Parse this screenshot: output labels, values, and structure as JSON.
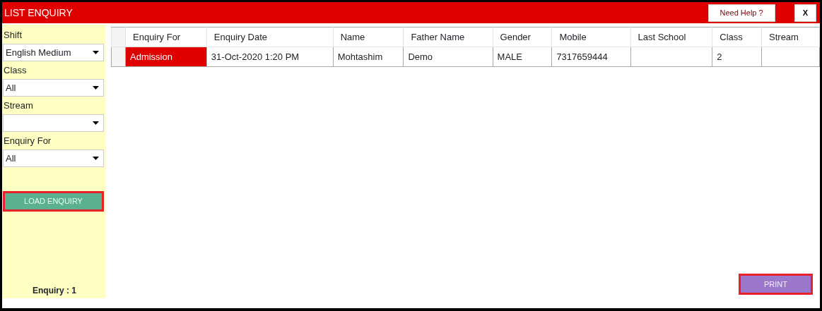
{
  "window": {
    "title": "LIST ENQUIRY"
  },
  "header_buttons": [
    {
      "kind": "help",
      "label": "Need Help ?"
    },
    {
      "kind": "close",
      "label": "X"
    }
  ],
  "filters": [
    {
      "label": "Shift",
      "value": "English Medium"
    },
    {
      "label": "Class",
      "value": "All"
    },
    {
      "label": "Stream"
    },
    {
      "label": "Enquiry For",
      "value": "All"
    }
  ],
  "load_button": "LOAD ENQUIRY",
  "count": "Enquiry : 1",
  "table": {
    "columns": [
      "Enquiry For",
      "Enquiry Date",
      "Name",
      "Father Name",
      "Gender",
      "Mobile",
      "Last School",
      "Class",
      "Stream"
    ],
    "rows": [
      {
        "cells": [
          {
            "text": "Admission",
            "selected": true
          },
          {
            "text": "31-Oct-2020 1:20 PM",
            "selected": false
          },
          {
            "text": "Mohtashim",
            "selected": false
          },
          {
            "text": "Demo",
            "selected": false
          },
          {
            "text": "MALE",
            "selected": false
          },
          {
            "text": "7317659444",
            "selected": false
          },
          {
            "selected": false
          },
          {
            "text": "2",
            "selected": false
          },
          {
            "selected": false
          }
        ]
      }
    ]
  },
  "print_button": "PRINT"
}
